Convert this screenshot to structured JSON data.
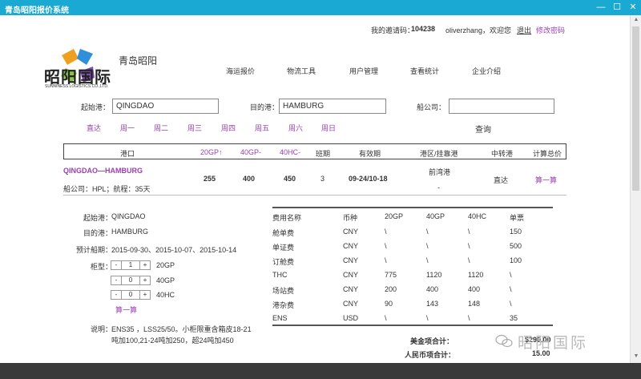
{
  "window": {
    "title": "青岛昭阳报价系统",
    "min": "—",
    "max": "☐",
    "close": "✕"
  },
  "header": {
    "invite_label": "我的邀请码：",
    "invite_code": "104238",
    "greeting": "oliverzhang，欢迎您",
    "logout": "退出",
    "change_pwd": "修改密码"
  },
  "brand": {
    "name_cn": "昭阳国际",
    "name_en": "SUNNINESS LOGISTICS CO.,LTD.",
    "company": "青岛昭阳"
  },
  "nav": [
    "海运报价",
    "物流工具",
    "用户管理",
    "查看统计",
    "企业介绍"
  ],
  "search": {
    "origin_label": "起始港：",
    "origin_value": "QINGDAO",
    "dest_label": "目的港：",
    "dest_value": "HAMBURG",
    "carrier_label": "船公司：",
    "carrier_value": "",
    "days": [
      "直达",
      "周一",
      "周二",
      "周三",
      "周四",
      "周五",
      "周六",
      "周日"
    ],
    "query_button": "查询"
  },
  "results_table": {
    "headers": [
      "港口",
      "20GP↑",
      "40GP-",
      "40HC-",
      "班期",
      "有效期",
      "港区/挂靠港",
      "中转港",
      "计算总价"
    ],
    "row": {
      "route": "QINGDAO—HAMBURG",
      "carrier_line": "船公司：HPL；航程：35天",
      "gp20": "255",
      "gp40": "400",
      "hc40": "450",
      "schedule": "3",
      "validity": "09-24/10-18",
      "terminal": "前湾港",
      "terminal_sub": "-",
      "transit": "直达",
      "calc": "算一算"
    }
  },
  "detail": {
    "origin_label": "起始港：",
    "origin": "QINGDAO",
    "dest_label": "目的港：",
    "dest": "HAMBURG",
    "sailing_label": "预计船期：",
    "sailing": "2015-09-30、2015-10-07、2015-10-14",
    "box_label": "柜型：",
    "boxes": [
      {
        "qty": "1",
        "type": "20GP"
      },
      {
        "qty": "0",
        "type": "40GP"
      },
      {
        "qty": "0",
        "type": "40HC"
      }
    ],
    "minus": "-",
    "plus": "+",
    "calc": "算一算",
    "note_label": "说明：",
    "note_line1": "ENS35 ，LSS25/50。小柜限重含箱皮18-21",
    "note_line2": "吨加100,21-24吨加250，超24吨加450"
  },
  "fees": {
    "headers": [
      "费用名称",
      "币种",
      "20GP",
      "40GP",
      "40HC",
      "单票"
    ],
    "rows": [
      [
        "舱单费",
        "CNY",
        "\\",
        "\\",
        "\\",
        "150"
      ],
      [
        "单证费",
        "CNY",
        "\\",
        "\\",
        "\\",
        "500"
      ],
      [
        "订舱费",
        "CNY",
        "\\",
        "\\",
        "\\",
        "100"
      ],
      [
        "THC",
        "CNY",
        "775",
        "1120",
        "1120",
        "\\"
      ],
      [
        "场站费",
        "CNY",
        "200",
        "400",
        "400",
        "\\"
      ],
      [
        "港杂费",
        "CNY",
        "90",
        "143",
        "148",
        "\\"
      ],
      [
        "ENS",
        "USD",
        "\\",
        "\\",
        "\\",
        "35"
      ]
    ],
    "usd_total_label": "美金项合计：",
    "usd_total": "$290.00",
    "cny_total_label": "人民币项合计：",
    "cny_total": "15.00"
  },
  "watermark": "昭阳国际"
}
